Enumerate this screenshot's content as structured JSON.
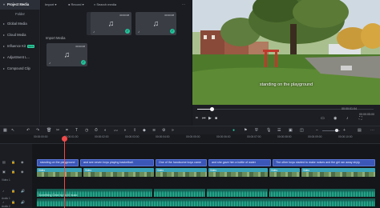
{
  "sidebar": {
    "items": [
      {
        "label": "Project Media",
        "active": true
      },
      {
        "label": "Folder"
      },
      {
        "label": "Global Media"
      },
      {
        "label": "Cloud Media"
      },
      {
        "label": "Influence Kit",
        "badge": "NEW"
      },
      {
        "label": "Adjustment L..."
      },
      {
        "label": "Compound Clip"
      }
    ]
  },
  "media": {
    "import_label": "Import",
    "record_label": "Record",
    "search_placeholder": "Search media",
    "import_media_label": "Import Media",
    "thumb_durations": [
      "00:00:08",
      "00:00:08",
      "00:00:08"
    ]
  },
  "preview": {
    "subtitle": "standing on the playground",
    "current_time": "00:00:01:04",
    "total_time": "00:00:05:00"
  },
  "ruler": {
    "labels": [
      "00:00:00:00",
      "00:00:01:00",
      "00:00:02:00",
      "00:00:03:00",
      "00:00:04:00",
      "00:00:05:00",
      "00:00:06:00",
      "00:00:07:00",
      "00:00:08:00",
      "00:00:09:00",
      "00:00:10:00"
    ]
  },
  "tracks": {
    "heads": [
      "Video 1",
      "Audio 1",
      "Audio 2"
    ],
    "subtitles": [
      "standing on the playground",
      "and see seven boys playing basketball.",
      "One of the handsome boys came",
      "and she gave him a bottle of water",
      "The other boys started to make noises and the girl ran away shyly."
    ],
    "video_labels": [
      "Video",
      "Video",
      "Video",
      "Video",
      "Video",
      "Video"
    ],
    "music_label": "Something Clean by By-ill music"
  },
  "colors": {
    "accent": "#27c9a2",
    "subtitle_clip": "#3b57b8",
    "video_clip": "#3aa4b8",
    "audio_wave": "#29c3a0",
    "playhead": "#f0494a"
  }
}
